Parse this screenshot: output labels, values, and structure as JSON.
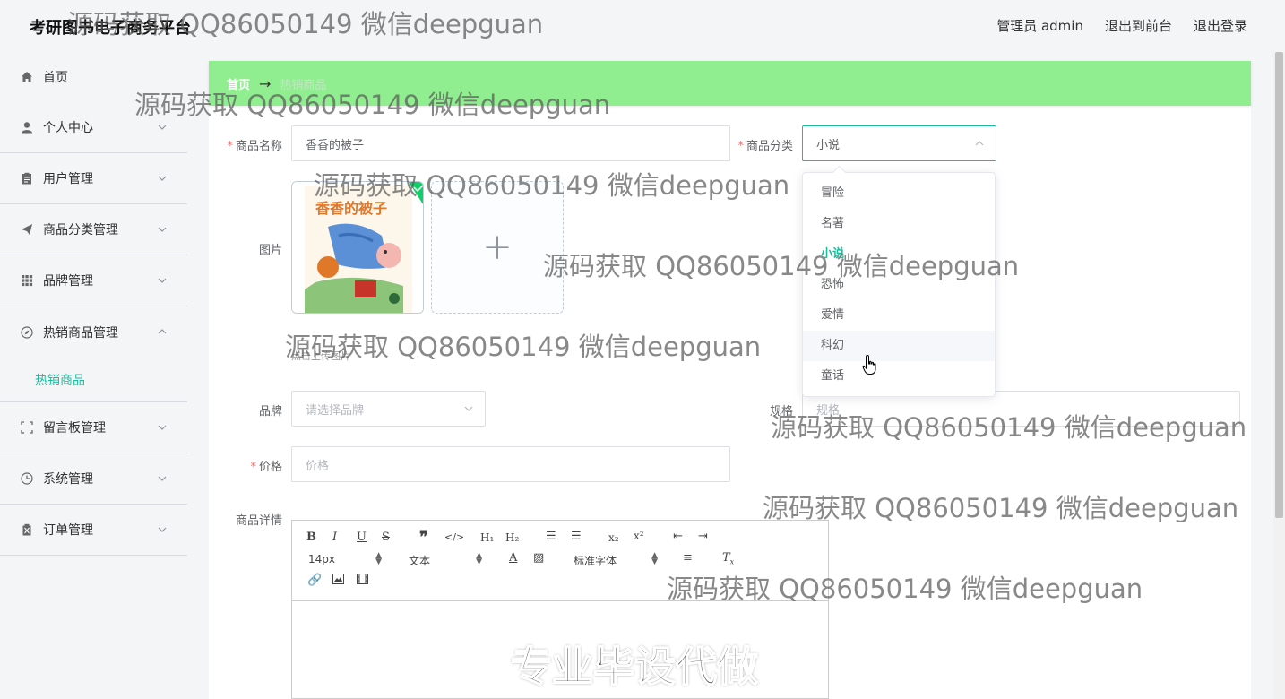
{
  "header": {
    "title": "考研图书电子商务平台",
    "admin_label": "管理员 admin",
    "back_front": "退出到前台",
    "logout": "退出登录"
  },
  "sidebar": {
    "items": [
      {
        "label": "首页",
        "icon": "home-icon"
      },
      {
        "label": "个人中心",
        "icon": "user-icon"
      },
      {
        "label": "用户管理",
        "icon": "clipboard-icon"
      },
      {
        "label": "商品分类管理",
        "icon": "send-icon"
      },
      {
        "label": "品牌管理",
        "icon": "grid-icon"
      },
      {
        "label": "热销商品管理",
        "icon": "compass-icon"
      },
      {
        "label": "留言板管理",
        "icon": "scan-icon"
      },
      {
        "label": "系统管理",
        "icon": "clock-icon"
      },
      {
        "label": "订单管理",
        "icon": "trash-icon"
      }
    ],
    "submenu_active": "热销商品"
  },
  "breadcrumb": {
    "home": "首页",
    "arrow": "→",
    "current": "热销商品"
  },
  "form": {
    "name_label": "商品名称",
    "name_value": "香香的被子",
    "category_label": "商品分类",
    "category_value": "小说",
    "image_label": "图片",
    "cover_title": "香香的被子",
    "upload_plus": "+",
    "upload_tip": "点击上传图片",
    "brand_label": "品牌",
    "brand_placeholder": "请选择品牌",
    "spec_label": "规格",
    "spec_placeholder": "规格",
    "price_label": "价格",
    "price_placeholder": "价格",
    "detail_label": "商品详情"
  },
  "editor": {
    "font_size": "14px",
    "header_type": "文本",
    "font_family": "标准字体"
  },
  "dropdown": {
    "options": [
      "冒险",
      "名著",
      "小说",
      "恐怖",
      "爱情",
      "科幻",
      "童话"
    ],
    "selected_index": 2,
    "hover_index": 5
  },
  "watermarks": {
    "text": "源码获取 QQ86050149 微信deepguan",
    "big": "专业毕设代做"
  },
  "colors": {
    "accent": "#1abc9c",
    "breadcrumb_bg": "#90ee90",
    "required": "#f56c6c"
  }
}
